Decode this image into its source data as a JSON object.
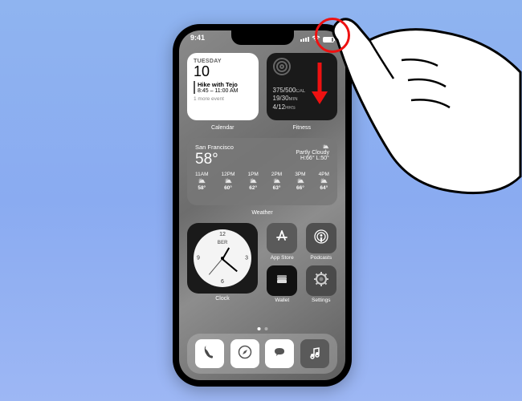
{
  "status": {
    "time": "9:41"
  },
  "calendar": {
    "widget_label": "Calendar",
    "day": "TUESDAY",
    "date": "10",
    "event_title": "Hike with Tejo",
    "event_time": "8:45 – 11:00 AM",
    "more": "1 more event"
  },
  "fitness": {
    "widget_label": "Fitness",
    "move": "375/500",
    "move_unit": "CAL",
    "exercise": "19/30",
    "exercise_unit": "MIN",
    "stand": "4/12",
    "stand_unit": "HRS"
  },
  "weather": {
    "widget_label": "Weather",
    "location": "San Francisco",
    "temp": "58°",
    "condition": "Partly Cloudy",
    "hilo": "H:66° L:50°",
    "hours": [
      {
        "h": "11AM",
        "t": "58°"
      },
      {
        "h": "12PM",
        "t": "60°"
      },
      {
        "h": "1PM",
        "t": "62°"
      },
      {
        "h": "2PM",
        "t": "63°"
      },
      {
        "h": "3PM",
        "t": "66°"
      },
      {
        "h": "4PM",
        "t": "64°"
      }
    ]
  },
  "clock": {
    "widget_label": "Clock",
    "tz": "BER"
  },
  "apps": {
    "appstore": "App Store",
    "podcasts": "Podcasts",
    "wallet": "Wallet",
    "settings": "Settings"
  },
  "dock": {
    "phone": "Phone",
    "safari": "Safari",
    "messages": "Messages",
    "music": "Music"
  },
  "annotation": {
    "gesture": "swipe-down-from-top-right",
    "start": "top-right corner of screen"
  }
}
